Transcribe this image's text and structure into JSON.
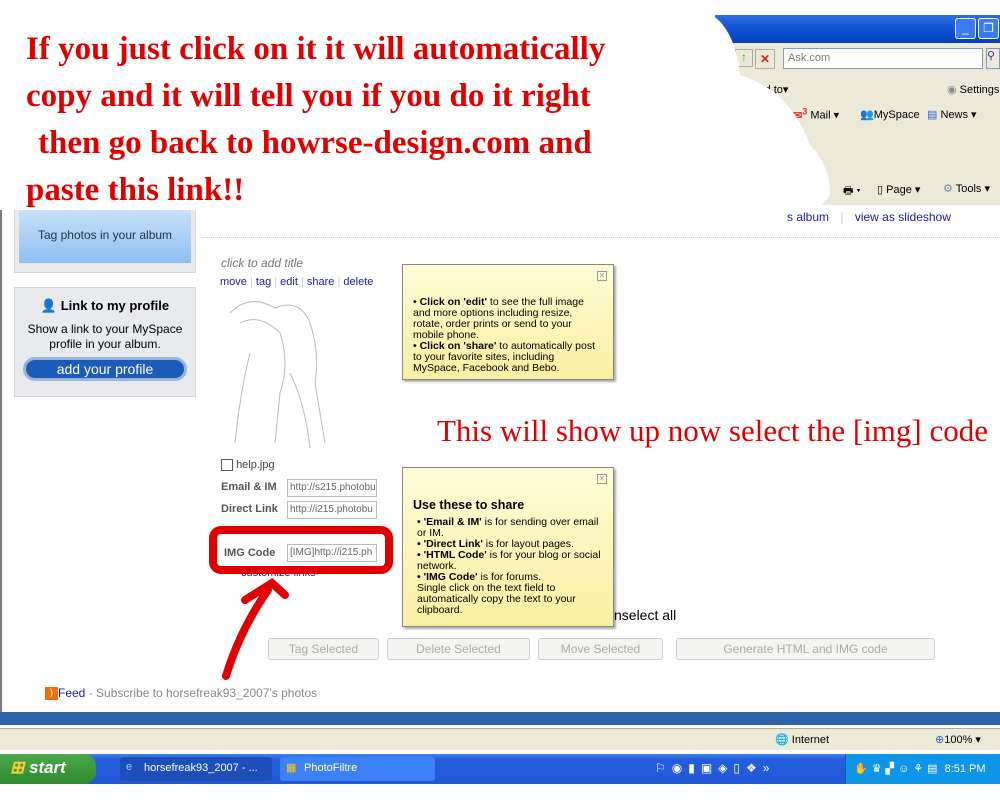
{
  "browser": {
    "search_placeholder": "Ask.com",
    "send_to": "Send to",
    "settings": "Settings",
    "messenger": "senger",
    "mail": "Mail",
    "mail_count": "3",
    "myspace": "MySpace",
    "news": "News",
    "page": "Page",
    "tools": "Tools"
  },
  "page": {
    "album_link": "s album",
    "slideshow_link": "view as slideshow",
    "tag_photos": "Tag photos in your album",
    "profile_box": {
      "title": "Link to my profile",
      "text": "Show a link to your MySpace profile in your album.",
      "button": "add your profile"
    },
    "photo": {
      "title_placeholder": "click to add title",
      "actions": [
        "move",
        "tag",
        "edit",
        "share",
        "delete"
      ],
      "filename": "help.jpg",
      "fields": [
        {
          "label": "Email & IM",
          "value": "http://s215.photobu"
        },
        {
          "label": "Direct Link",
          "value": "http://i215.photobu"
        },
        {
          "label": "IMG Code",
          "value": "[IMG]http://i215.ph"
        }
      ],
      "customize": "customize links"
    },
    "tip1": {
      "line1_bold": "• Click on 'edit'",
      "line1": " to see the full image and more options including resize, rotate, order prints or send to your mobile phone.",
      "line2_bold": "• Click on 'share'",
      "line2": " to automatically post to your favorite sites, including MySpace, Facebook and Bebo."
    },
    "tip2": {
      "title": "Use these to share",
      "items": [
        {
          "b": "• 'Email & IM'",
          "t": " is for sending over email or IM."
        },
        {
          "b": "• 'Direct Link'",
          "t": " is for layout pages."
        },
        {
          "b": "• 'HTML Code'",
          "t": " is for your blog or social network."
        },
        {
          "b": "• 'IMG Code'",
          "t": " is for forums."
        }
      ],
      "note": "Single click on the text field to automatically copy the text to your clipboard."
    },
    "unselect": "nselect all",
    "buttons": [
      "Tag Selected",
      "Delete Selected",
      "Move Selected",
      "Generate HTML and IMG code"
    ],
    "feed": "Feed",
    "feed_text": " - Subscribe to horsefreak93_2007's photos"
  },
  "annotations": {
    "top": [
      "If you just click on it it will automatically",
      "copy and it will tell you if you do it right",
      "then go back to howrse-design.com and",
      "paste this link!!"
    ],
    "middle": "This will show up now select the [img] code",
    "color": "#e00000"
  },
  "status": {
    "zone": "Internet",
    "zoom": "100%"
  },
  "taskbar": {
    "start": "start",
    "tasks": [
      "horsefreak93_2007 - ...",
      "PhotoFiltre"
    ],
    "clock": "8:51 PM"
  }
}
